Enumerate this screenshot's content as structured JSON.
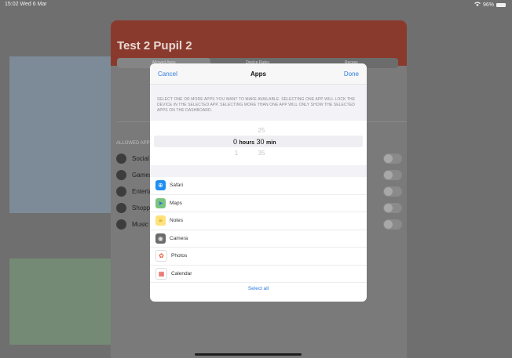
{
  "status": {
    "time": "15:02",
    "day": "Wed 6 Mar",
    "battery": "96%",
    "wifi_icon": "wifi-icon"
  },
  "background": {
    "title": "Test 2 Pupil 2",
    "segments": [
      "Allowed Apps",
      "Device Rules",
      "Recess"
    ],
    "section_label": "ALLOWED APPS",
    "rows": [
      "Social",
      "Games",
      "Entertainment",
      "Shopping",
      "Music"
    ]
  },
  "modal": {
    "cancel": "Cancel",
    "title": "Apps",
    "done": "Done",
    "description": "SELECT ONE OR MORE APPS YOU WANT TO MAKE AVAILABLE. SELECTING ONE APP WILL LOCK THE DEVICE IN THE SELECTED APP. SELECTING MORE THAN ONE APP WILL ONLY SHOW THE SELECTED APPS ON THE DASHBOARD.",
    "picker": {
      "above_minutes": "25",
      "hours_value": "0",
      "hours_label": "hours",
      "minutes_value": "30",
      "minutes_label": "min",
      "below_hours": "1",
      "below_minutes": "35"
    },
    "apps": [
      {
        "name": "Safari",
        "icon": "safari-icon",
        "glyph": "⊕",
        "bg": "#1f8ef1",
        "fg": "#ffffff"
      },
      {
        "name": "Maps",
        "icon": "maps-icon",
        "glyph": "➤",
        "bg": "#7cc47f",
        "fg": "#2f6bd8"
      },
      {
        "name": "Notes",
        "icon": "notes-icon",
        "glyph": "≡",
        "bg": "#ffe27a",
        "fg": "#c49a10"
      },
      {
        "name": "Camera",
        "icon": "camera-icon",
        "glyph": "◉",
        "bg": "#6b6b6b",
        "fg": "#e5e5e5"
      },
      {
        "name": "Photos",
        "icon": "photos-icon",
        "glyph": "✿",
        "bg": "#ffffff",
        "fg": "#e8552f"
      },
      {
        "name": "Calendar",
        "icon": "calendar-icon",
        "glyph": "▦",
        "bg": "#ffffff",
        "fg": "#e0413a"
      }
    ],
    "select_all": "Select all"
  }
}
